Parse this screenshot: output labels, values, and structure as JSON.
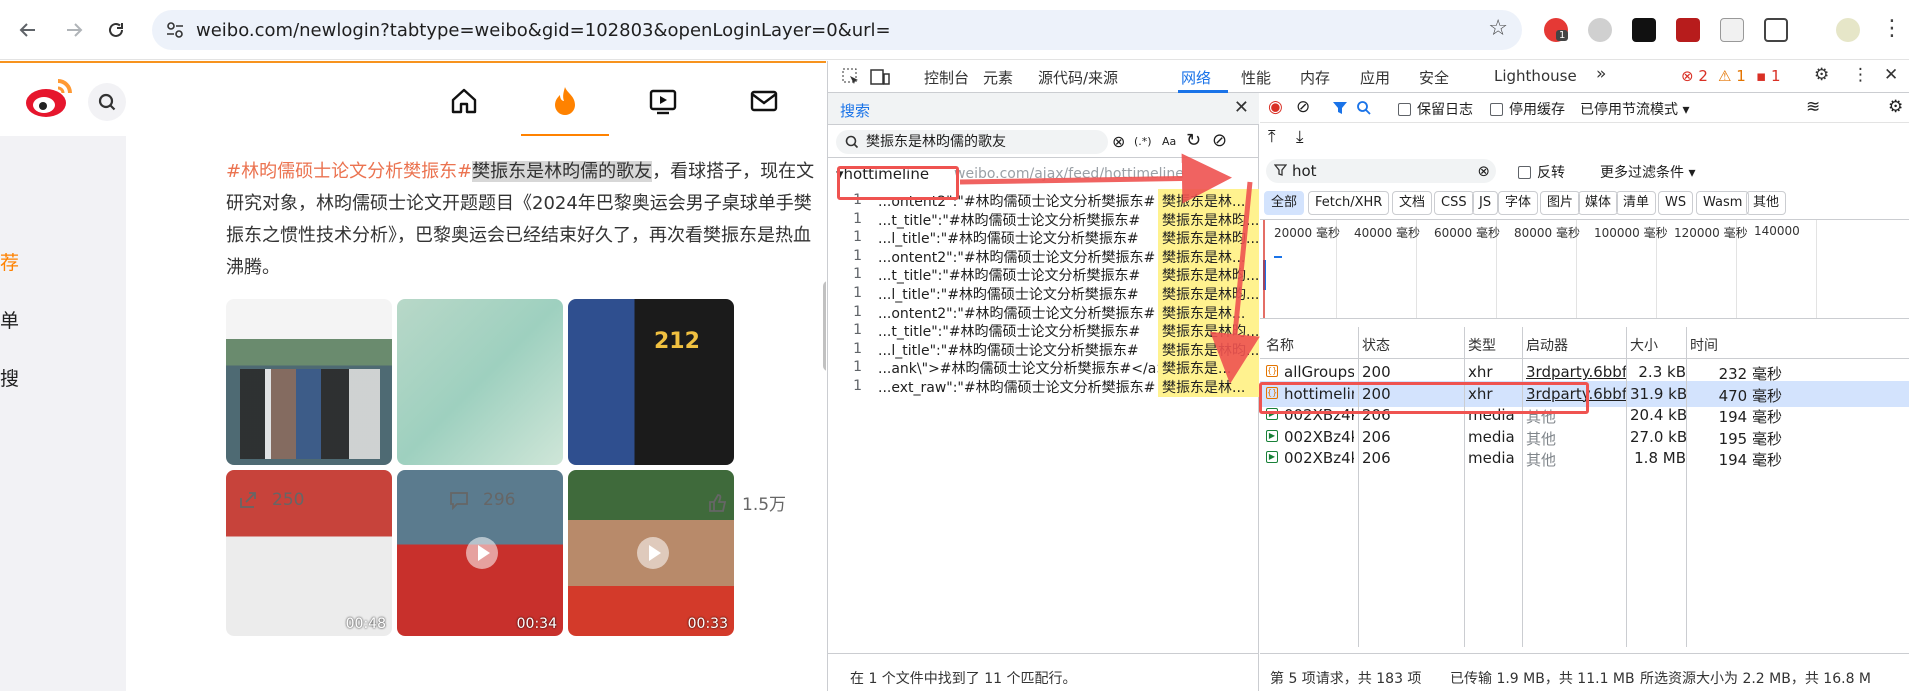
{
  "browser": {
    "url": "weibo.com/newlogin?tabtype=weibo&gid=102803&openLoginLayer=0&url=",
    "ext_badge": "1"
  },
  "weibo": {
    "left_nav": [
      "荐",
      "单",
      "搜"
    ],
    "post": {
      "hashtag": "#林昀儒硕士论文分析樊振东#",
      "highlight": "樊振东是林昀儒的歌友",
      "body": "，看球搭子，现在文研究对象，林昀儒硕士论文开题题目《2024年巴黎奥运会男子桌球单手樊振东之惯性技术分析》，巴黎奥运会已经结束好久了，再次看樊振东是热血沸腾。"
    },
    "video_durations": [
      "00:48",
      "00:34",
      "00:33"
    ],
    "actions": {
      "forward": "250",
      "comment": "296",
      "like": "1.5万"
    }
  },
  "devtools": {
    "tabs": [
      "控制台",
      "元素",
      "源代码/来源",
      "网络",
      "性能",
      "内存",
      "应用",
      "安全",
      "Lighthouse"
    ],
    "active_tab": "网络",
    "error_count": "2",
    "warn_count": "1",
    "issue_count": "1",
    "search": {
      "title": "搜索",
      "query": "樊振东是林昀儒的歌友",
      "regex_label": "(.*)",
      "case_label": "Aa",
      "file_name": "hottimeline",
      "file_url": "weibo.com/ajax/feed/hottimeline",
      "results": [
        {
          "n": "1",
          "text": "...ontent2\":\"#林昀儒硕士论文分析樊振东#",
          "hit": "樊振东是林..."
        },
        {
          "n": "1",
          "text": "...t_title\":\"#林昀儒硕士论文分析樊振东#",
          "hit": "樊振东是林昀..."
        },
        {
          "n": "1",
          "text": "...l_title\":\"#林昀儒硕士论文分析樊振东#",
          "hit": "樊振东是林昀..."
        },
        {
          "n": "1",
          "text": "...ontent2\":\"#林昀儒硕士论文分析樊振东#",
          "hit": "樊振东是林..."
        },
        {
          "n": "1",
          "text": "...t_title\":\"#林昀儒硕士论文分析樊振东#",
          "hit": "樊振东是林昀..."
        },
        {
          "n": "1",
          "text": "...l_title\":\"#林昀儒硕士论文分析樊振东#",
          "hit": "樊振东是林昀..."
        },
        {
          "n": "1",
          "text": "...ontent2\":\"#林昀儒硕士论文分析樊振东#",
          "hit": "樊振东是林..."
        },
        {
          "n": "1",
          "text": "...t_title\":\"#林昀儒硕士论文分析樊振东#",
          "hit": "樊振东是林昀..."
        },
        {
          "n": "1",
          "text": "...l_title\":\"#林昀儒硕士论文分析樊振东#",
          "hit": "樊振东是林昀..."
        },
        {
          "n": "1",
          "text": "...ank\\\">#林昀儒硕士论文分析樊振东#</a>",
          "hit": "樊振东是..."
        },
        {
          "n": "1",
          "text": "...ext_raw\":\"#林昀儒硕士论文分析樊振东#",
          "hit": "樊振东是林..."
        }
      ],
      "status": "在 1 个文件中找到了 11 个匹配行。"
    },
    "network": {
      "preserve_log": "保留日志",
      "disable_cache": "停用缓存",
      "throttle": "已停用节流模式",
      "filter_value": "hot",
      "invert": "反转",
      "more_filters": "更多过滤条件",
      "types": [
        "全部",
        "Fetch/XHR",
        "文档",
        "CSS",
        "JS",
        "字体",
        "图片",
        "媒体",
        "清单",
        "WS",
        "Wasm",
        "其他"
      ],
      "timeline_labels": [
        "20000 毫秒",
        "40000 毫秒",
        "60000 毫秒",
        "80000 毫秒",
        "100000 毫秒",
        "120000 毫秒",
        "140000"
      ],
      "columns": [
        "名称",
        "状态",
        "类型",
        "启动器",
        "大小",
        "时间"
      ],
      "rows": [
        {
          "name": "allGroups...",
          "status": "200",
          "type": "xhr",
          "initiator": "3rdparty.6bbf8c2",
          "size": "2.3 kB",
          "time": "232 毫秒"
        },
        {
          "name": "hottimelin...",
          "status": "200",
          "type": "xhr",
          "initiator": "3rdparty.6bbf8c2",
          "size": "31.9 kB",
          "time": "470 毫秒"
        },
        {
          "name": "002XBz4kj...",
          "status": "206",
          "type": "media",
          "initiator": "其他",
          "size": "20.4 kB",
          "time": "194 毫秒"
        },
        {
          "name": "002XBz4kj...",
          "status": "206",
          "type": "media",
          "initiator": "其他",
          "size": "27.0 kB",
          "time": "195 毫秒"
        },
        {
          "name": "002XBz4kj...",
          "status": "206",
          "type": "media",
          "initiator": "其他",
          "size": "1.8 MB",
          "time": "194 毫秒"
        }
      ],
      "status_requests": "第 5 项请求，共 183 项",
      "status_transferred": "已传输 1.9 MB，共 11.1 MB",
      "status_resources": "所选资源大小为 2.2 MB，共 16.8 M"
    }
  },
  "colors": {
    "weibo_orange": "#ff8200",
    "devtools_blue": "#1a73e8",
    "annotation_red": "#ef5350",
    "search_hit": "#fff28f"
  }
}
